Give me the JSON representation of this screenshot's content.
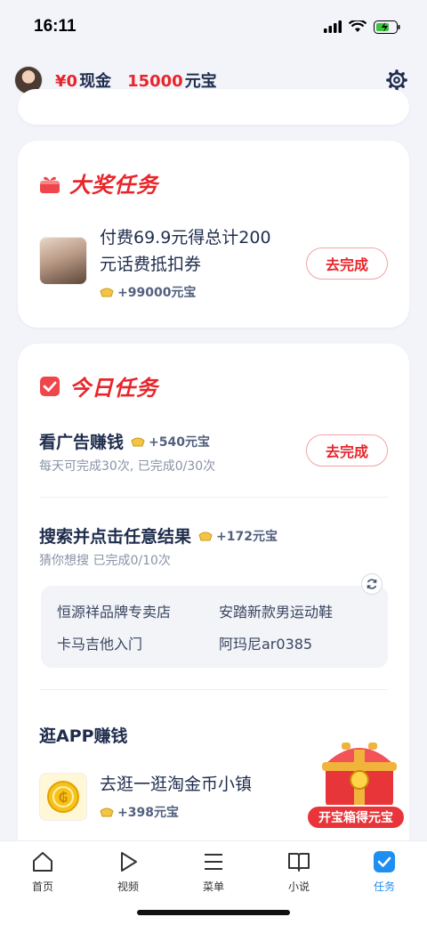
{
  "status": {
    "time": "16:11"
  },
  "header": {
    "cash_amount": "¥0",
    "cash_unit": "现金",
    "coins_amount": "15000",
    "coins_unit": "元宝"
  },
  "big_prize": {
    "title": "大奖任务",
    "task": {
      "title_line1": "付费69.9元得总计200",
      "title_line2": "元话费抵扣券",
      "reward": "+99000元宝",
      "button": "去完成"
    }
  },
  "today": {
    "title": "今日任务",
    "ad_task": {
      "title": "看广告赚钱",
      "reward": "+540元宝",
      "sub": "每天可完成30次, 已完成0/30次",
      "button": "去完成"
    },
    "search_task": {
      "title": "搜索并点击任意结果",
      "reward": "+172元宝",
      "sub": "猜你想搜 已完成0/10次",
      "keywords": [
        "恒源祥品牌专卖店",
        "安踏新款男运动鞋",
        "卡马吉他入门",
        "阿玛尼ar0385"
      ]
    },
    "app_section_title": "逛APP赚钱",
    "app_task": {
      "title": "去逛一逛淘金币小镇",
      "reward": "+398元宝"
    }
  },
  "chest": {
    "label": "开宝箱得元宝"
  },
  "tabs": [
    {
      "label": "首页",
      "icon": "home-icon"
    },
    {
      "label": "视频",
      "icon": "play-icon"
    },
    {
      "label": "菜单",
      "icon": "menu-icon"
    },
    {
      "label": "小说",
      "icon": "book-icon"
    },
    {
      "label": "任务",
      "icon": "task-check-icon"
    }
  ],
  "colors": {
    "accent_red": "#e8252b",
    "active_tab": "#1f8ef1",
    "text_navy": "#1f2d4d"
  }
}
